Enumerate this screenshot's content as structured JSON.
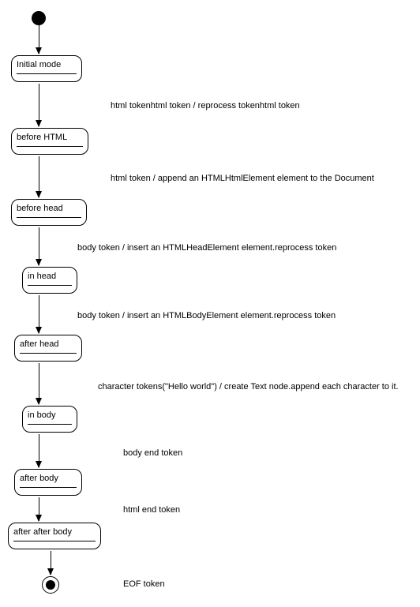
{
  "states": {
    "s1": "Initial mode",
    "s2": "before HTML",
    "s3": "before head",
    "s4": "in head",
    "s5": "after head",
    "s6": "in body",
    "s7": "after body",
    "s8": "after after body"
  },
  "edges": {
    "e1": "html tokenhtml token / reprocess tokenhtml token",
    "e2": "html token / append an HTMLHtmlElement element to the Document",
    "e3": "body token / insert an HTMLHeadElement element.reprocess token",
    "e4": "body token / insert an HTMLBodyElement element.reprocess token",
    "e5": "character tokens(\"Hello world\") / create Text node.append each character to it.",
    "e6": "body end token",
    "e7": "html end token",
    "e8": "EOF token"
  }
}
